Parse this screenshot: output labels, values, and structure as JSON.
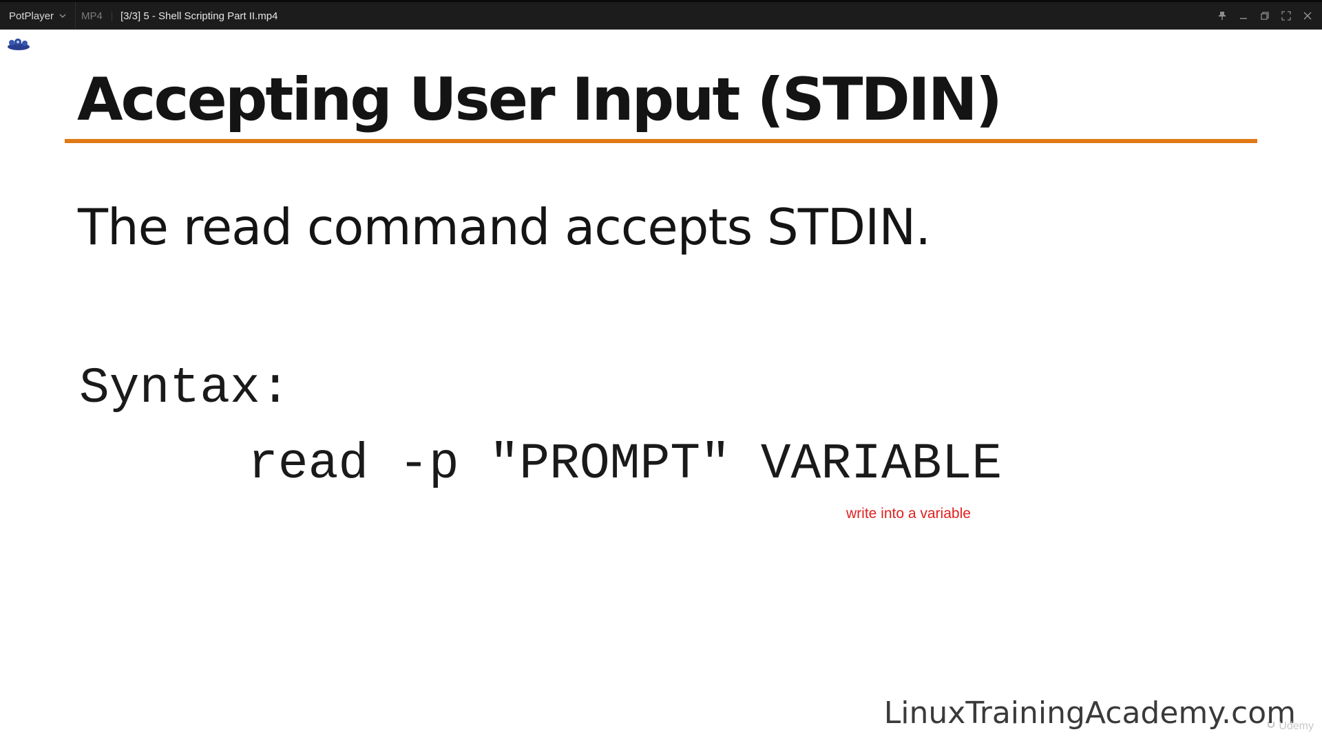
{
  "titlebar": {
    "app_name": "PotPlayer",
    "format": "MP4",
    "file_title": "[3/3] 5 - Shell Scripting Part II.mp4",
    "controls": [
      "pin-icon",
      "minimize-icon",
      "restore-icon",
      "fullscreen-icon",
      "close-icon"
    ]
  },
  "slide": {
    "title": "Accepting User Input (STDIN)",
    "body": "The read command accepts STDIN.",
    "syntax_label": "Syntax:",
    "syntax_code": "read -p \"PROMPT\" VARIABLE",
    "annotation": "write into a variable",
    "site": "LinuxTrainingAcademy.com",
    "udemy": "Udemy"
  },
  "colors": {
    "titlebar_bg": "#1c1c1c",
    "accent_rule": "#e07a16",
    "annotation": "#e02020"
  }
}
